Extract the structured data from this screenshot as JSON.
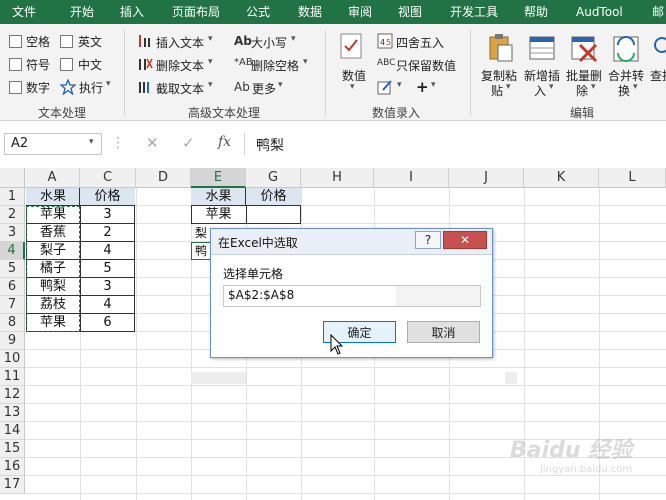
{
  "tabs": [
    "文件",
    "开始",
    "插入",
    "页面布局",
    "公式",
    "数据",
    "审阅",
    "视图",
    "开发工具",
    "帮助",
    "AudTool",
    "邮"
  ],
  "ribbon": {
    "text_process": {
      "checkboxes": [
        "空格",
        "英文",
        "符号",
        "中文",
        "数字"
      ],
      "execute": "执行",
      "group_label": "文本处理"
    },
    "advanced": {
      "insert": "插入文本",
      "delete": "删除文本",
      "extract": "截取文本",
      "case": "大小写",
      "delete_space": "删除空格",
      "more": "更多",
      "group_label": "高级文本处理"
    },
    "numeric": {
      "value": "数值",
      "round": "四舍五入",
      "keep_value": "只保留数值",
      "group_label": "数值录入"
    },
    "edit": {
      "copy_paste_1": "复制粘",
      "copy_paste_2": "贴",
      "add_insert_1": "新增插",
      "add_insert_2": "入",
      "batch_delete_1": "批量删",
      "batch_delete_2": "除",
      "merge_convert_1": "合并转",
      "merge_convert_2": "换",
      "find_1": "查找",
      "group_label": "编辑"
    }
  },
  "formula_bar": {
    "name_box": "A2",
    "fx": "fx",
    "content": "鸭梨"
  },
  "columns": [
    "A",
    "C",
    "D",
    "E",
    "G",
    "H",
    "I",
    "J",
    "K",
    "L"
  ],
  "rows": [
    "1",
    "2",
    "3",
    "4",
    "5",
    "6",
    "7",
    "8",
    "9",
    "10",
    "11",
    "12",
    "13",
    "14",
    "15",
    "16",
    "17"
  ],
  "table1": {
    "header": [
      "水果",
      "价格"
    ],
    "rows": [
      [
        "苹果",
        "3"
      ],
      [
        "香蕉",
        "2"
      ],
      [
        "梨子",
        "4"
      ],
      [
        "橘子",
        "5"
      ],
      [
        "鸭梨",
        "3"
      ],
      [
        "荔枝",
        "4"
      ],
      [
        "苹果",
        "6"
      ]
    ]
  },
  "table2": {
    "header": [
      "水果",
      "价格"
    ],
    "rows": [
      [
        "苹果",
        ""
      ],
      [
        "梨",
        ""
      ],
      [
        "鸭",
        ""
      ]
    ]
  },
  "dialog": {
    "title": "在Excel中选取",
    "help": "?",
    "label": "选择单元格",
    "input_value": "$A$2:$A$8",
    "ok": "确定",
    "cancel": "取消"
  },
  "watermark": "Baidu 经验",
  "watermark_url": "jingyan.baidu.com"
}
